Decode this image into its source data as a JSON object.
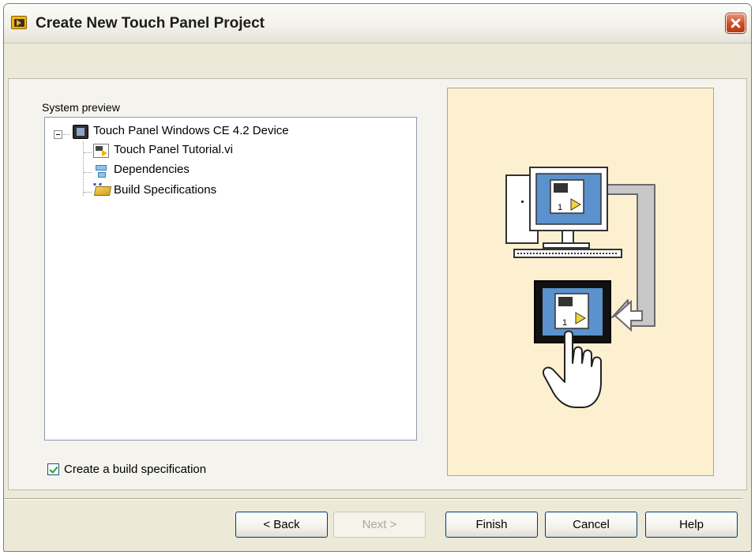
{
  "window": {
    "title": "Create New Touch Panel Project",
    "app_icon": "labview-icon",
    "close_icon": "close-icon"
  },
  "system_preview": {
    "label": "System preview",
    "tree": [
      {
        "label": "Touch Panel Windows CE 4.2 Device",
        "icon": "touch-panel-device-icon",
        "expanded": true
      },
      {
        "label": "Touch Panel Tutorial.vi",
        "icon": "vi-file-icon"
      },
      {
        "label": "Dependencies",
        "icon": "dependencies-icon"
      },
      {
        "label": "Build Specifications",
        "icon": "build-specifications-icon"
      }
    ]
  },
  "build_spec": {
    "label": "Create a build specification",
    "checked": true
  },
  "illustration": {
    "description_icon": "pc-to-touch-panel-illustration",
    "vi_number": "1",
    "background_color": "#fdf0d0"
  },
  "buttons": {
    "back": "< Back",
    "next": "Next >",
    "finish": "Finish",
    "cancel": "Cancel",
    "help": "Help"
  },
  "colors": {
    "dialog_face": "#ece9d8",
    "accent_blue": "#5b91cc",
    "close_red": "#cf4a26"
  }
}
